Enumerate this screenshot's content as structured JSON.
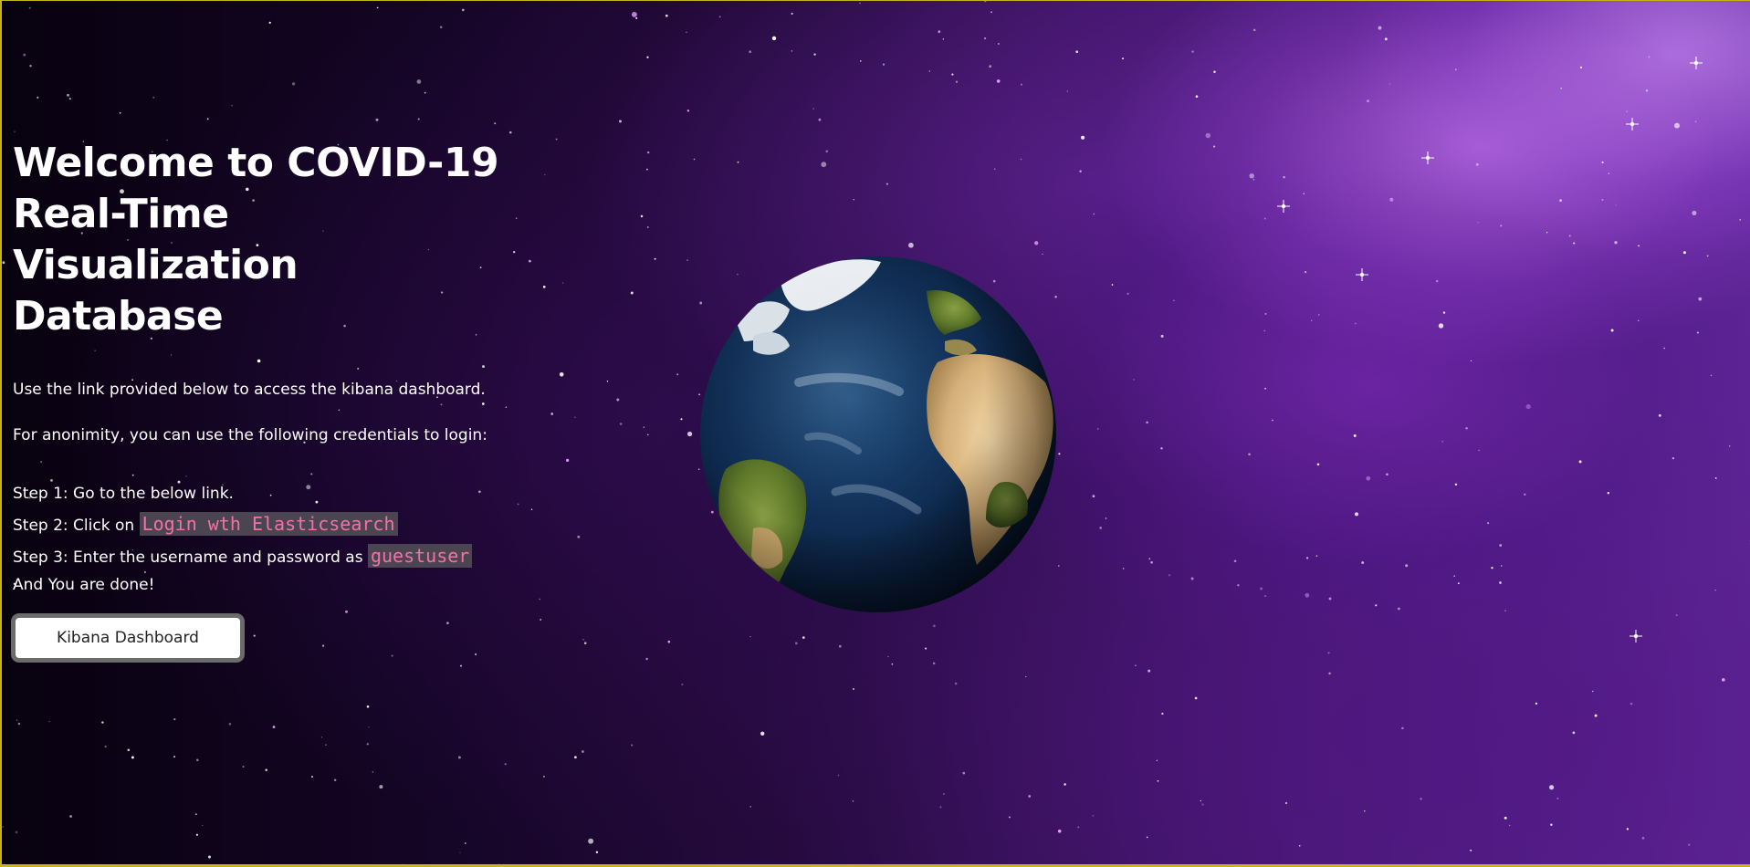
{
  "hero": {
    "title_line1": "Welcome to COVID-19",
    "title_line2": "Real-Time Visualization",
    "title_line3": "Database",
    "intro": "Use the link provided below to access the kibana dashboard.",
    "credentials_note": "For anonimity, you can use the following credentials to login:"
  },
  "steps": {
    "step1": "Step 1: Go to the below link.",
    "step2_prefix": "Step 2: Click on ",
    "step2_code": "Login wth Elasticsearch",
    "step3_prefix": "Step 3: Enter the username and password as ",
    "step3_code": "guestuser",
    "done": "And You are done!"
  },
  "button": {
    "label": "Kibana Dashboard"
  },
  "colors": {
    "code_text": "#f272a8",
    "code_bg": "#4a4550",
    "frame_border": "#c9b21a"
  },
  "icons": {
    "globe": "earth-globe-icon"
  }
}
